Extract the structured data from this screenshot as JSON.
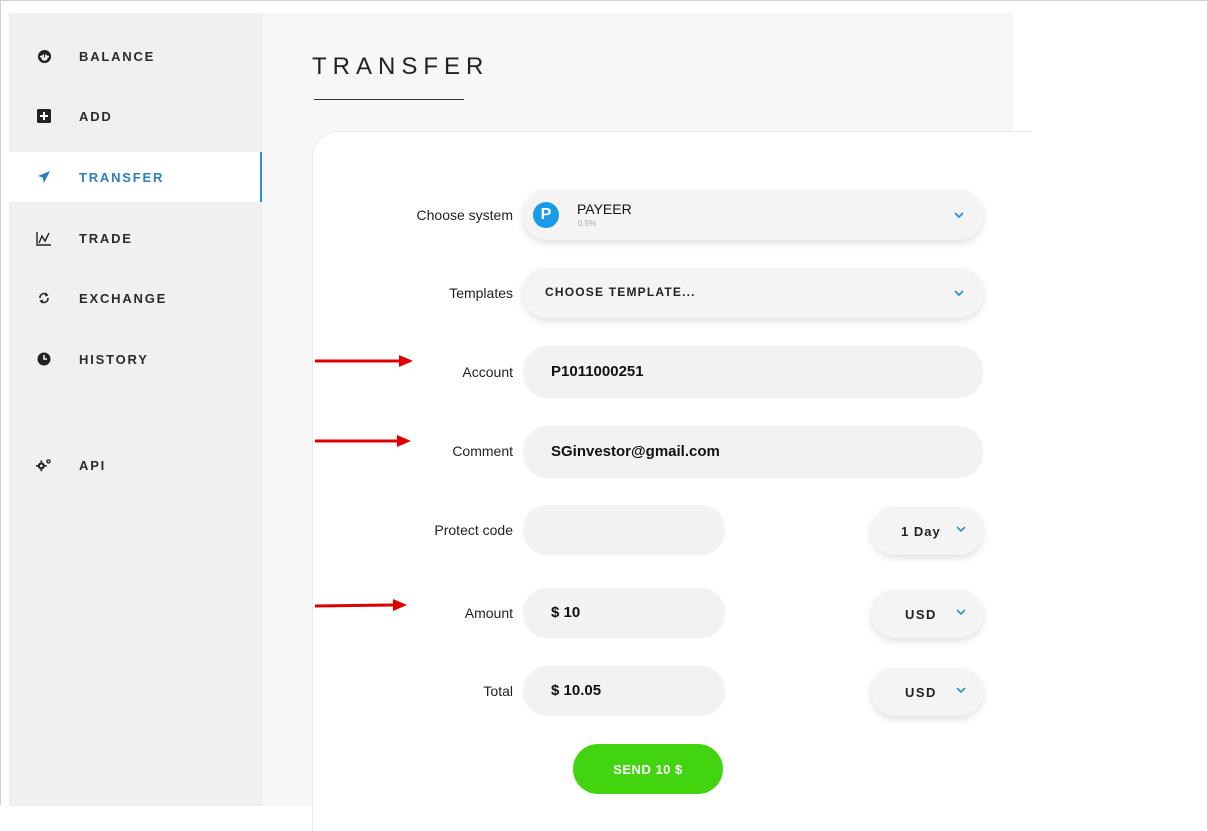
{
  "sidebar": {
    "items": [
      {
        "label": "BALANCE",
        "icon": "dashboard-icon"
      },
      {
        "label": "ADD",
        "icon": "plus-square-icon"
      },
      {
        "label": "TRANSFER",
        "icon": "paper-plane-icon",
        "active": true
      },
      {
        "label": "TRADE",
        "icon": "chart-line-icon"
      },
      {
        "label": "EXCHANGE",
        "icon": "refresh-icon"
      },
      {
        "label": "HISTORY",
        "icon": "clock-icon"
      },
      {
        "label": "API",
        "icon": "gears-icon"
      }
    ]
  },
  "main": {
    "title": "TRANSFER",
    "form": {
      "system_label": "Choose system",
      "system_name": "PAYEER",
      "system_fee": "0.5%",
      "system_logo_letter": "P",
      "templates_label": "Templates",
      "templates_value": "CHOOSE TEMPLATE...",
      "account_label": "Account",
      "account_value": "P1011000251",
      "comment_label": "Comment",
      "comment_value": "SGinvestor@gmail.com",
      "protect_label": "Protect code",
      "protect_value": "",
      "protect_period": "1 Day",
      "amount_label": "Amount",
      "amount_value": "$ 10",
      "amount_currency": "USD",
      "total_label": "Total",
      "total_value": "$ 10.05",
      "total_currency": "USD",
      "send_label": "SEND 10 $"
    }
  },
  "colors": {
    "accent": "#2b7ec2",
    "send_button": "#42d40f",
    "payeer_logo": "#1a9be8",
    "annotation_arrow": "#e00000"
  }
}
